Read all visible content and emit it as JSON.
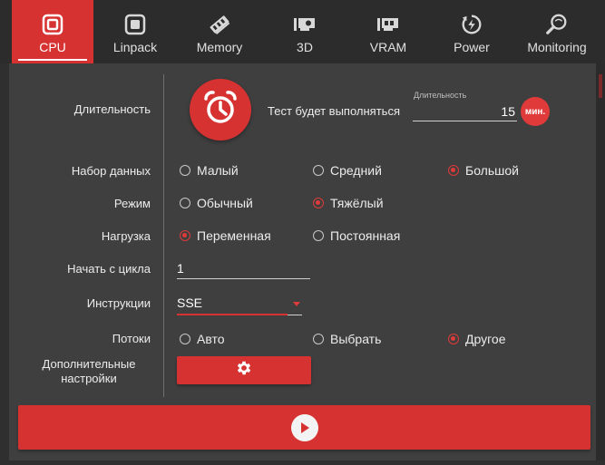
{
  "tabs": [
    {
      "label": "CPU",
      "icon": "cpu-icon",
      "active": true
    },
    {
      "label": "Linpack",
      "icon": "chip-icon",
      "active": false
    },
    {
      "label": "Memory",
      "icon": "memory-icon",
      "active": false
    },
    {
      "label": "3D",
      "icon": "gpu-icon",
      "active": false
    },
    {
      "label": "VRAM",
      "icon": "vram-icon",
      "active": false
    },
    {
      "label": "Power",
      "icon": "power-icon",
      "active": false
    },
    {
      "label": "Monitoring",
      "icon": "monitoring-icon",
      "active": false
    }
  ],
  "duration": {
    "label": "Длительность",
    "text": "Тест будет выполняться",
    "caption": "Длительность",
    "value": "15",
    "unit": "мин."
  },
  "dataset": {
    "label": "Набор данных",
    "options": [
      "Малый",
      "Средний",
      "Большой"
    ],
    "selected": "Большой"
  },
  "mode": {
    "label": "Режим",
    "options": [
      "Обычный",
      "Тяжёлый"
    ],
    "selected": "Тяжёлый"
  },
  "load": {
    "label": "Нагрузка",
    "options": [
      "Переменная",
      "Постоянная"
    ],
    "selected": "Переменная"
  },
  "start_cycle": {
    "label": "Начать с цикла",
    "value": "1"
  },
  "instructions": {
    "label": "Инструкции",
    "value": "SSE"
  },
  "threads": {
    "label": "Потоки",
    "options": [
      "Авто",
      "Выбрать",
      "Другое"
    ],
    "selected": "Другое"
  },
  "advanced": {
    "label_line1": "Дополнительные",
    "label_line2": "настройки"
  },
  "colors": {
    "accent": "#d63232",
    "background": "#3f3f3f",
    "tabbar": "#2c2c2c"
  }
}
